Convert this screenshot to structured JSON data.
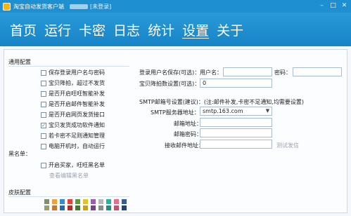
{
  "titlebar": {
    "title": "淘宝自动发货客户端",
    "status": "[未登录]"
  },
  "nav": {
    "items": [
      "首页",
      "运行",
      "卡密",
      "日志",
      "统计",
      "设置",
      "关于"
    ],
    "active_index": 5
  },
  "general": {
    "section_label": "通用配置",
    "options": [
      {
        "label": "保存登录用户名与密码",
        "checked": false
      },
      {
        "label": "宝贝降拍，超过不发货",
        "checked": false
      },
      {
        "label": "是否开启旺旺智能补发",
        "checked": false
      },
      {
        "label": "是否开启邮件智能补发",
        "checked": false
      },
      {
        "label": "是否开启网页发货接口",
        "checked": false
      },
      {
        "label": "宝贝发货成功软件通知",
        "checked": true
      },
      {
        "label": "若卡密不足则通知管理",
        "checked": false
      },
      {
        "label": "电脑开机时，自动运行",
        "checked": false
      }
    ]
  },
  "login": {
    "label": "登录用户名保存(可选)：",
    "user_label": "用户名：",
    "user_value": "",
    "pass_label": "密码：",
    "pass_value": ""
  },
  "limit": {
    "label": "宝贝降拍数设置(可选)：",
    "value": "0"
  },
  "smtp": {
    "heading": "SMTP邮箱号设置(建议)：(注:邮件补发,卡密不足通知,均需要设置)",
    "server_label": "SMTP服务器地址：",
    "server_value": "smtp.163.com",
    "account_label": "邮箱地址：",
    "account_value": "",
    "password_label": "邮箱密码：",
    "password_value": "",
    "receiver_label": "接收邮件地址：",
    "receiver_value": "",
    "test_label": "测试发信"
  },
  "blacklist": {
    "section_label": "黑名单：",
    "option": {
      "label": "开启买家，旺旺黑名单",
      "checked": false
    },
    "edit_link": "查看编辑黑名单"
  },
  "skin": {
    "section_label": "皮肤配置",
    "colors_row1": [
      "#7f8f6a",
      "#f0a23a",
      "#2e8ed8",
      "#d9473d",
      "#5c9a3c",
      "#e2c132",
      "#9b5bb8",
      "#b7b7b7",
      "#2cb3a0",
      "#e36f8a",
      "#355c9c"
    ],
    "colors_row2": [
      "#96a06e",
      "#c8772e",
      "#2569b0",
      "#ad2f2a",
      "#3f7d2a",
      "#c5a21f",
      "#7b3d99",
      "#8c8c8c",
      "#1b8f80",
      "#c2506c",
      "#24427a"
    ]
  }
}
